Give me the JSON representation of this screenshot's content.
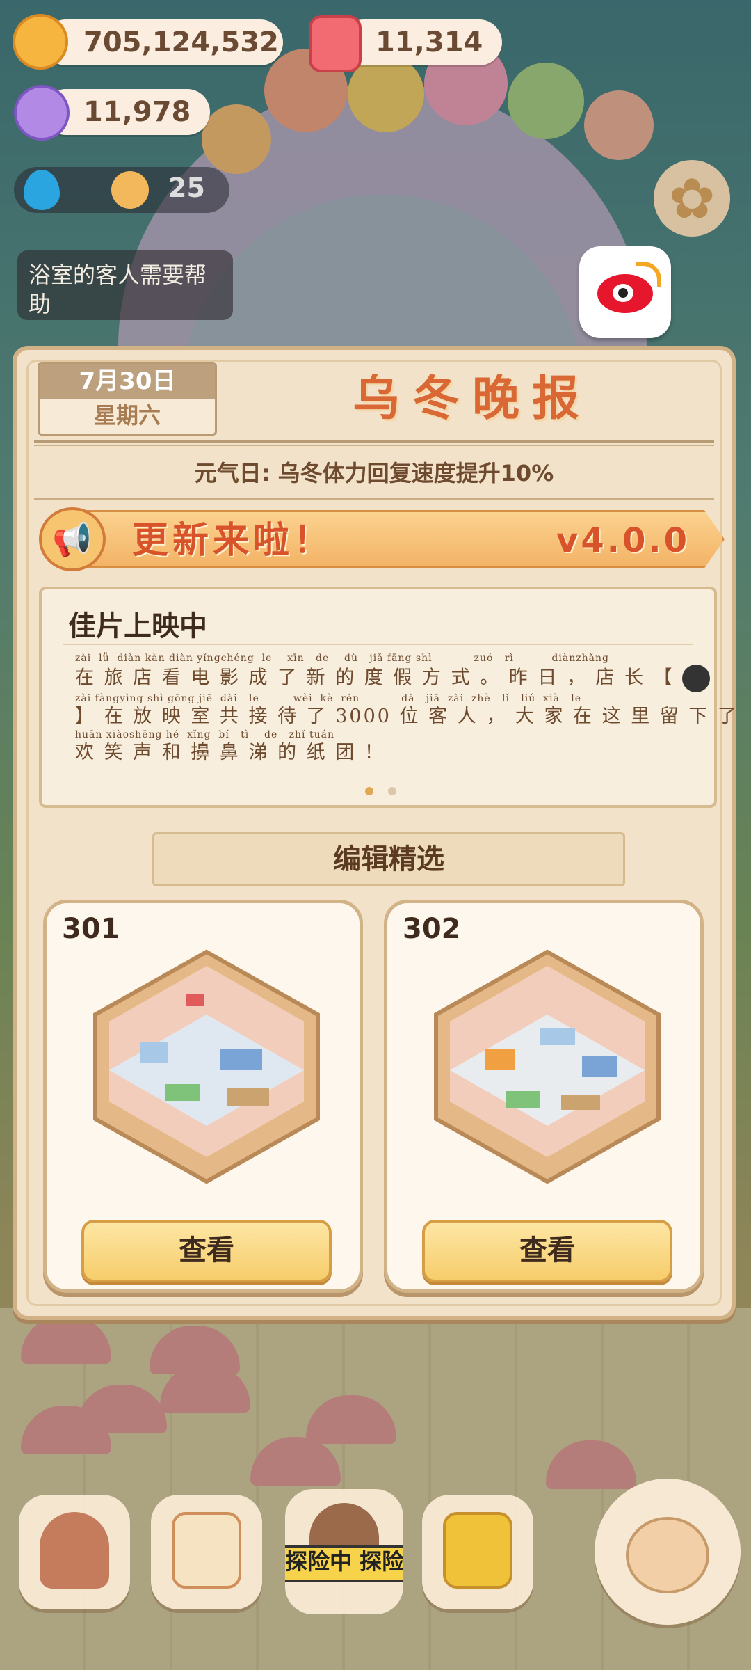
{
  "hud": {
    "coins": "705,124,532",
    "gems": "11,314",
    "crystals": "11,978",
    "energy": "25",
    "icons": [
      "cookie-coin-icon",
      "red-candy-icon",
      "crystal-icon",
      "water-drop-icon",
      "smiley-icon",
      "gear-icon",
      "weibo-icon"
    ]
  },
  "tip": {
    "text": "浴室的客人需要帮助"
  },
  "newspaper": {
    "date": "7月30日",
    "weekday": "星期六",
    "title": "乌冬晚报",
    "subtitle": "元气日: 乌冬体力回复速度提升10%",
    "update_banner": {
      "text": "更新来啦！",
      "version": "v4.0.0"
    },
    "story": {
      "heading": "佳片上映中",
      "pinyin1": "zài  lǚ  diàn kàn diàn yǐngchéng  le    xīn   de    dù   jiǎ fāng shì           zuó   rì          diànzhǎng",
      "line1": "在 旅 店 看 电 影 成 了 新 的 度 假 方 式 。 昨 日 ， 店 长 【",
      "pinyin2": "zài fàngyìng shì gōng jiē  dài   le         wèi  kè  rén           dà   jiā  zài  zhè   lǐ   liú  xià   le",
      "line2": "】 在 放 映 室 共 接 待 了 3000 位 客 人 ， 大 家 在 这 里 留 下 了",
      "pinyin3": "huān xiàoshēng hé  xǐng  bí   tì    de   zhǐ tuán",
      "line3": "欢 笑 声 和 擤 鼻 涕 的 纸 团 ！"
    },
    "editor_pick": "编辑精选",
    "rooms": [
      {
        "number": "301",
        "button": "查看"
      },
      {
        "number": "302",
        "button": "查看"
      }
    ]
  },
  "dock": {
    "explore_label": "探险中 探险",
    "items": [
      "house-icon",
      "notebook-icon",
      "explore-icon",
      "shop-bag-icon",
      "fish-character-icon"
    ]
  },
  "colors": {
    "accent": "#d96834",
    "paper": "#f1e2c9",
    "button": "#f7cd6b",
    "pagination_active": "#e0a854",
    "pagination_inactive": "#dcc7a8"
  }
}
